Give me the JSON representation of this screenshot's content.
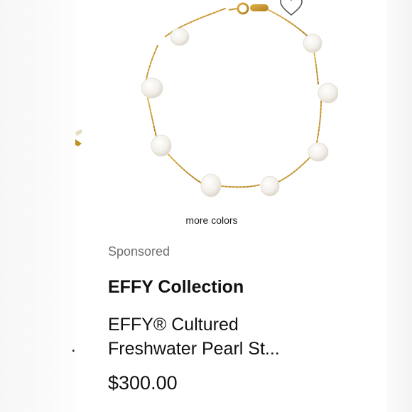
{
  "product": {
    "more_colors_label": "more colors",
    "sponsored_label": "Sponsored",
    "brand": "EFFY Collection",
    "title_line1": "EFFY® Cultured",
    "title_line2": "Freshwater Pearl St...",
    "price": "$300.00",
    "image_alt": "Gold chain bracelet with freshwater pearls"
  },
  "neighbor": {
    "price_fragment": "."
  },
  "icons": {
    "wishlist": "heart-outline-icon"
  },
  "colors": {
    "text_primary": "#111111",
    "text_secondary": "#6f6f6f",
    "gold": "#c9962e",
    "pearl": "#f7f5f1"
  }
}
